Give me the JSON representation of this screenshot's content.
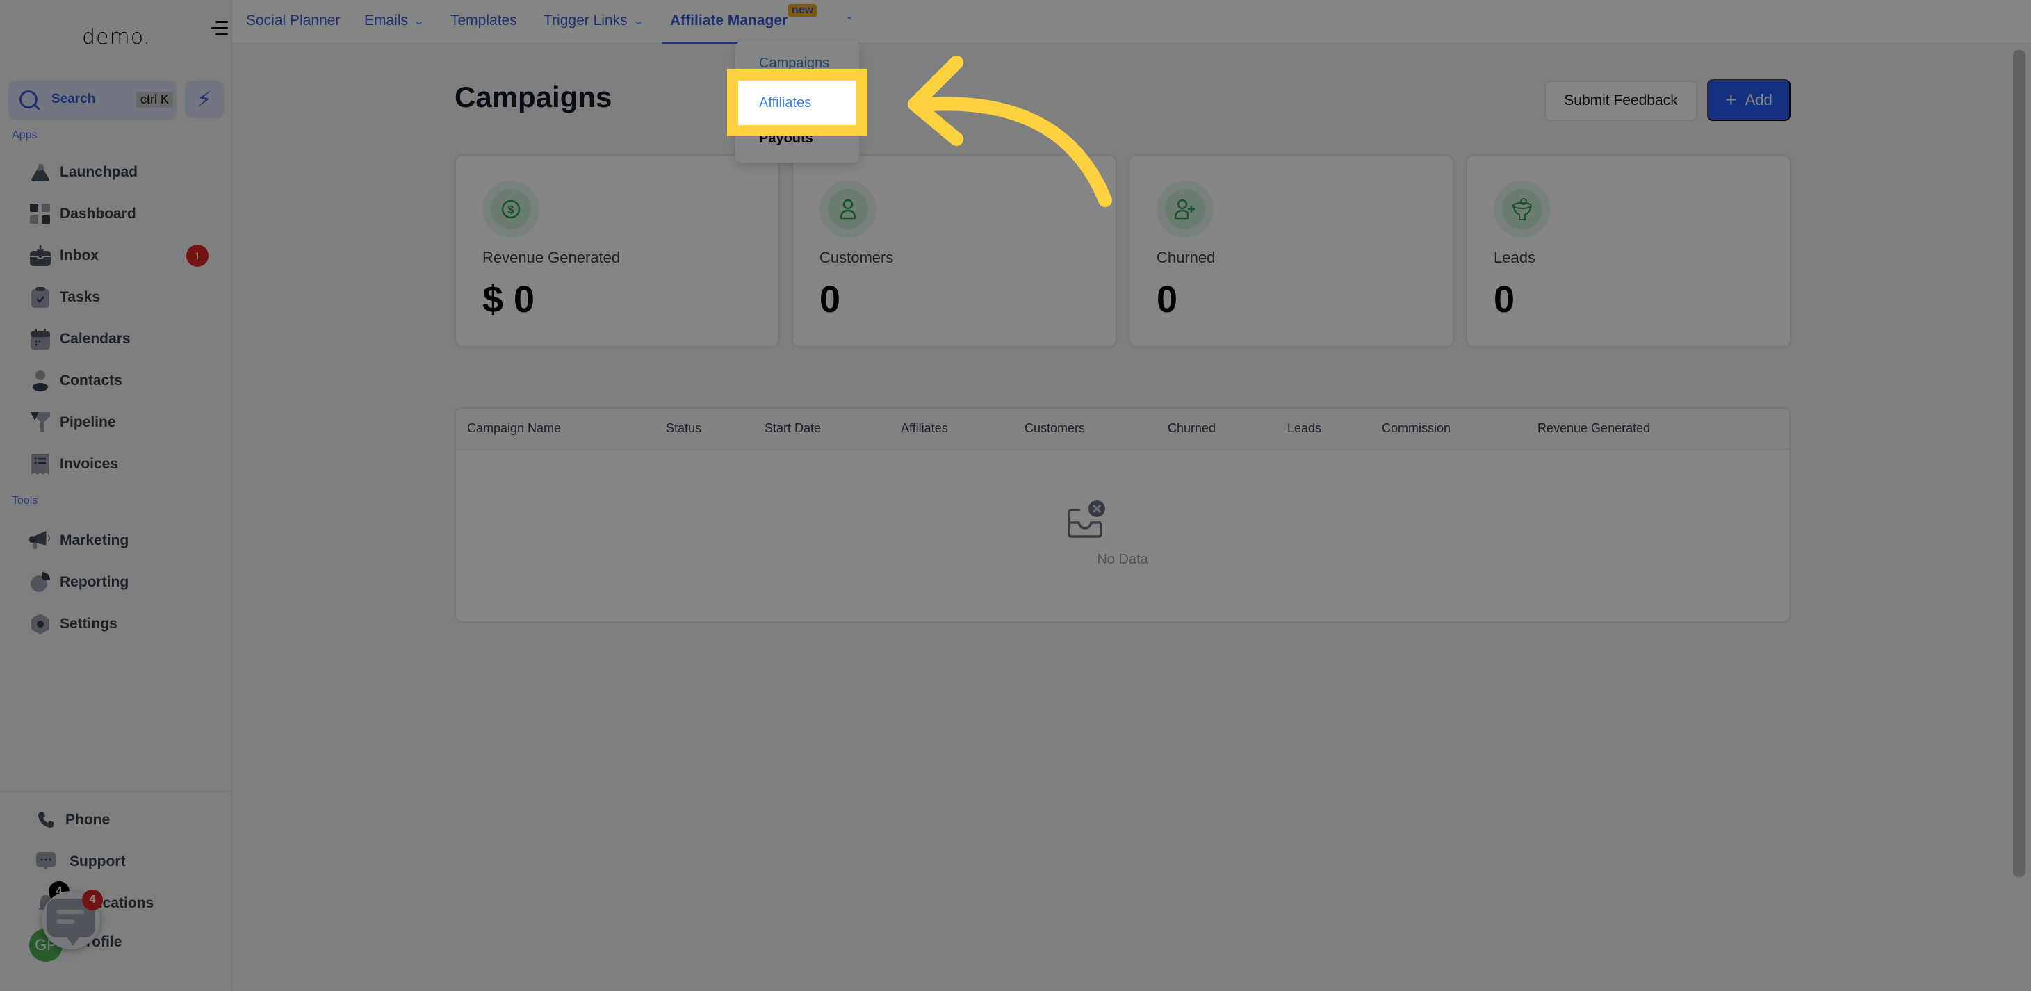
{
  "sidebar": {
    "logo": "demo.",
    "search": {
      "label": "Search",
      "shortcut": "ctrl K"
    },
    "sections": {
      "apps": "Apps",
      "tools": "Tools"
    },
    "apps": [
      {
        "label": "Launchpad",
        "icon": "rocket-icon"
      },
      {
        "label": "Dashboard",
        "icon": "grid-icon"
      },
      {
        "label": "Inbox",
        "icon": "inbox-icon",
        "badge": "1"
      },
      {
        "label": "Tasks",
        "icon": "clipboard-check-icon"
      },
      {
        "label": "Calendars",
        "icon": "calendar-icon"
      },
      {
        "label": "Contacts",
        "icon": "user-icon"
      },
      {
        "label": "Pipeline",
        "icon": "funnel-icon"
      },
      {
        "label": "Invoices",
        "icon": "receipt-icon"
      }
    ],
    "tools": [
      {
        "label": "Marketing",
        "icon": "megaphone-icon"
      },
      {
        "label": "Reporting",
        "icon": "pie-chart-icon"
      },
      {
        "label": "Settings",
        "icon": "gear-icon"
      }
    ],
    "bottom": [
      {
        "label": "Phone",
        "icon": "phone-icon"
      },
      {
        "label": "Support",
        "icon": "chat-icon"
      },
      {
        "label": "Notifications",
        "icon": "bell-icon",
        "badge": "4"
      },
      {
        "label": "Profile",
        "icon": "avatar",
        "initials": "GP"
      }
    ],
    "chat_widget_badge": "4"
  },
  "topnav": {
    "tabs": [
      {
        "label": "Social Planner"
      },
      {
        "label": "Emails",
        "has_dropdown": true
      },
      {
        "label": "Templates"
      },
      {
        "label": "Trigger Links",
        "has_dropdown": true
      },
      {
        "label": "Affiliate Manager",
        "active": true,
        "badge": "new",
        "has_dropdown": true
      }
    ],
    "dropdown": [
      "Campaigns",
      "Affiliates",
      "Payouts"
    ],
    "highlighted_item": "Affiliates"
  },
  "main": {
    "title": "Campaigns",
    "buttons": {
      "feedback": "Submit Feedback",
      "add": "Add"
    },
    "stats": [
      {
        "label": "Revenue Generated",
        "value": "$ 0",
        "icon": "dollar-circle-icon"
      },
      {
        "label": "Customers",
        "value": "0",
        "icon": "user-icon"
      },
      {
        "label": "Churned",
        "value": "0",
        "icon": "user-plus-icon"
      },
      {
        "label": "Leads",
        "value": "0",
        "icon": "funnel-icon"
      }
    ],
    "table": {
      "columns": [
        "Campaign Name",
        "Status",
        "Start Date",
        "Affiliates",
        "Customers",
        "Churned",
        "Leads",
        "Commission",
        "Revenue Generated"
      ],
      "rows": [],
      "empty_text": "No Data"
    }
  },
  "colors": {
    "accent": "#3b5bdb",
    "primary_button": "#2a5cf5",
    "highlight": "#fdd140",
    "badge_red": "#dc2626",
    "stat_icon_green": "#2f9e55"
  }
}
